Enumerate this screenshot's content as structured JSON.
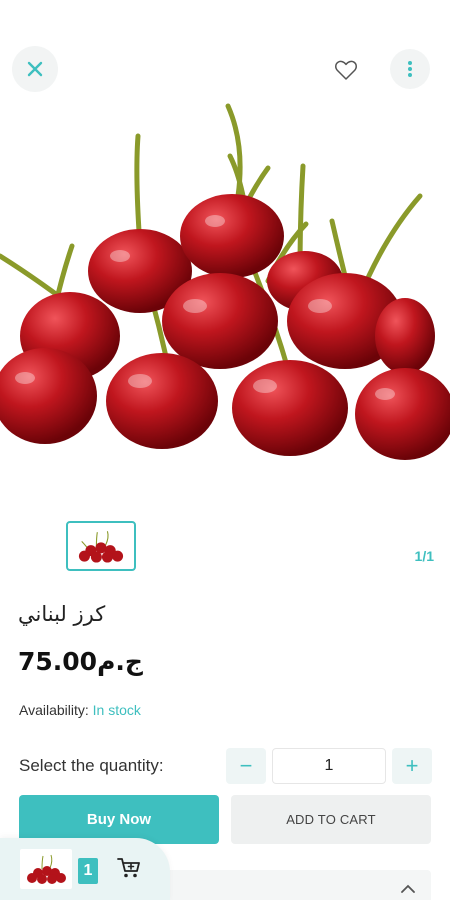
{
  "header": {
    "close_icon": "close-icon",
    "favorite_icon": "heart-icon",
    "more_icon": "more-vertical-icon"
  },
  "gallery": {
    "counter": "1/1"
  },
  "product": {
    "title": "كرز لبناني",
    "price": "ج.م75.00",
    "availability_label": "Availability:",
    "availability_value": "In stock"
  },
  "quantity": {
    "label": "Select the quantity:",
    "value": "1",
    "minus": "−",
    "plus": "+"
  },
  "actions": {
    "buy_now": "Buy Now",
    "add_to_cart": "ADD TO CART"
  },
  "mini_cart": {
    "count": "1",
    "icon": "cart-icon"
  },
  "colors": {
    "accent": "#3ebfbf",
    "cherry": "#b3131a",
    "stem": "#8a9a2a"
  }
}
